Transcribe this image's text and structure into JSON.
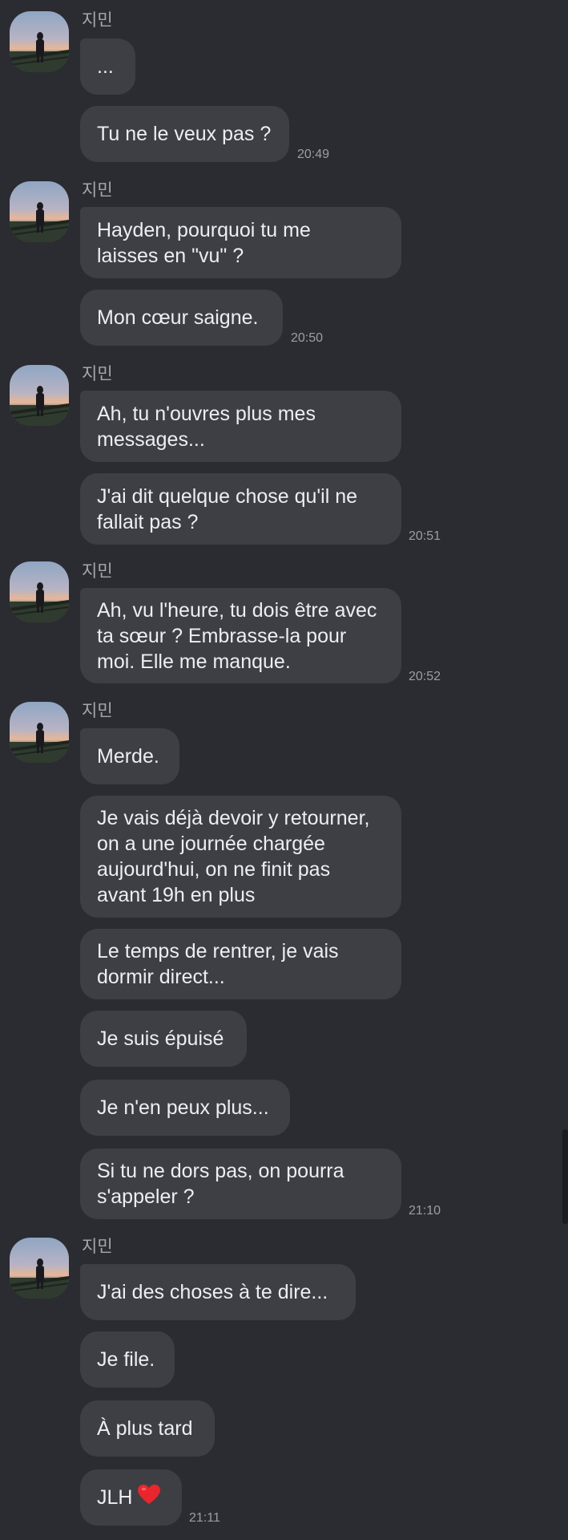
{
  "sender": "지민",
  "groups": [
    {
      "messages": [
        {
          "text": "..."
        },
        {
          "text": "Tu ne le veux pas ?",
          "time": "20:49"
        }
      ]
    },
    {
      "messages": [
        {
          "text": "Hayden, pourquoi tu me\nlaisses en \"vu\" ?"
        },
        {
          "text": "Mon cœur saigne.",
          "time": "20:50"
        }
      ]
    },
    {
      "messages": [
        {
          "text": "Ah, tu n'ouvres plus mes\nmessages..."
        },
        {
          "text": "J'ai dit quelque chose qu'il ne\nfallait pas ?",
          "time": "20:51"
        }
      ]
    },
    {
      "messages": [
        {
          "text": "Ah, vu l'heure, tu dois être avec\nta sœur ? Embrasse-la pour\nmoi. Elle me manque.",
          "time": "20:52"
        }
      ]
    },
    {
      "messages": [
        {
          "text": "Merde."
        },
        {
          "text": "Je vais déjà devoir y retourner,\non a une journée chargée\naujourd'hui, on ne finit pas\navant 19h en plus"
        },
        {
          "text": "Le temps de rentrer, je vais\ndormir direct..."
        },
        {
          "text": "Je suis épuisé"
        },
        {
          "text": "Je n'en peux plus..."
        },
        {
          "text": "Si tu ne dors pas, on pourra\ns'appeler ?",
          "time": "21:10"
        }
      ]
    },
    {
      "messages": [
        {
          "text": "J'ai des choses à te dire..."
        },
        {
          "text": "Je file."
        },
        {
          "text": "À plus tard"
        },
        {
          "text": "JLH",
          "emoji": "red-heart",
          "time": "21:11"
        }
      ]
    }
  ]
}
